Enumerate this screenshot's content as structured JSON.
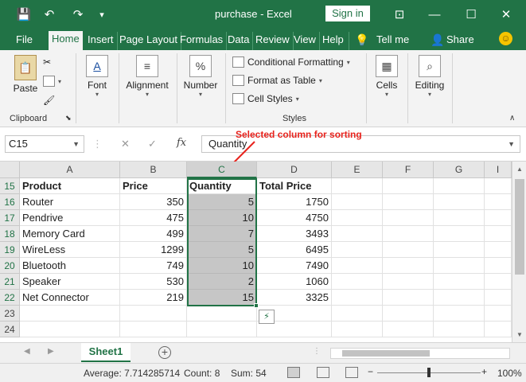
{
  "window": {
    "title": "purchase  -  Excel",
    "sign_in": "Sign in",
    "quick_access": {
      "save": "💾",
      "undo": "↶",
      "redo": "↷",
      "customize": "▾"
    },
    "controls": {
      "display_options": "⊡",
      "minimize": "—",
      "maximize": "☐",
      "close": "✕"
    }
  },
  "menu": {
    "tabs": [
      "File",
      "Home",
      "Insert",
      "Page Layout",
      "Formulas",
      "Data",
      "Review",
      "View",
      "Help"
    ],
    "active": "Home",
    "tell_me": "Tell me",
    "share": "Share"
  },
  "ribbon": {
    "clipboard": {
      "paste": "Paste",
      "group": "Clipboard"
    },
    "font": "Font",
    "alignment": "Alignment",
    "number": "Number",
    "number_icon": "%",
    "styles": {
      "conditional_formatting": "Conditional Formatting",
      "format_as_table": "Format as Table",
      "cell_styles": "Cell Styles",
      "group": "Styles"
    },
    "cells": "Cells",
    "editing": "Editing"
  },
  "formula_bar": {
    "name_box": "C15",
    "cancel": "✕",
    "enter": "✓",
    "fx": "fx",
    "value": "Quantity"
  },
  "annotation": "Selected column for sorting",
  "sheet": {
    "columns": [
      "A",
      "B",
      "C",
      "D",
      "E",
      "F",
      "G",
      "I"
    ],
    "selected_column": "C",
    "rows": [
      {
        "num": "15",
        "cells": [
          "Product",
          "Price",
          "Quantity",
          "Total Price"
        ],
        "header": true
      },
      {
        "num": "16",
        "cells": [
          "Router",
          "350",
          "5",
          "1750"
        ]
      },
      {
        "num": "17",
        "cells": [
          "Pendrive",
          "475",
          "10",
          "4750"
        ]
      },
      {
        "num": "18",
        "cells": [
          "Memory Card",
          "499",
          "7",
          "3493"
        ]
      },
      {
        "num": "19",
        "cells": [
          "WireLess",
          "1299",
          "5",
          "6495"
        ]
      },
      {
        "num": "20",
        "cells": [
          "Bluetooth",
          "749",
          "10",
          "7490"
        ]
      },
      {
        "num": "21",
        "cells": [
          "Speaker",
          "530",
          "2",
          "1060"
        ]
      },
      {
        "num": "22",
        "cells": [
          "Net Connector",
          "219",
          "15",
          "3325"
        ]
      },
      {
        "num": "23",
        "cells": [
          "",
          "",
          "",
          ""
        ]
      },
      {
        "num": "24",
        "cells": [
          "",
          "",
          "",
          ""
        ]
      }
    ]
  },
  "tabs_bar": {
    "sheet_name": "Sheet1",
    "prev": "◀",
    "next": "▶",
    "add": "+"
  },
  "status": {
    "average": "Average: 7.714285714",
    "count": "Count: 8",
    "sum": "Sum: 54",
    "zoom": "100%",
    "zoom_minus": "−",
    "zoom_plus": "+"
  },
  "colors": {
    "accent": "#217346",
    "annotation": "#e8231d",
    "selection": "#c6c6c6"
  }
}
